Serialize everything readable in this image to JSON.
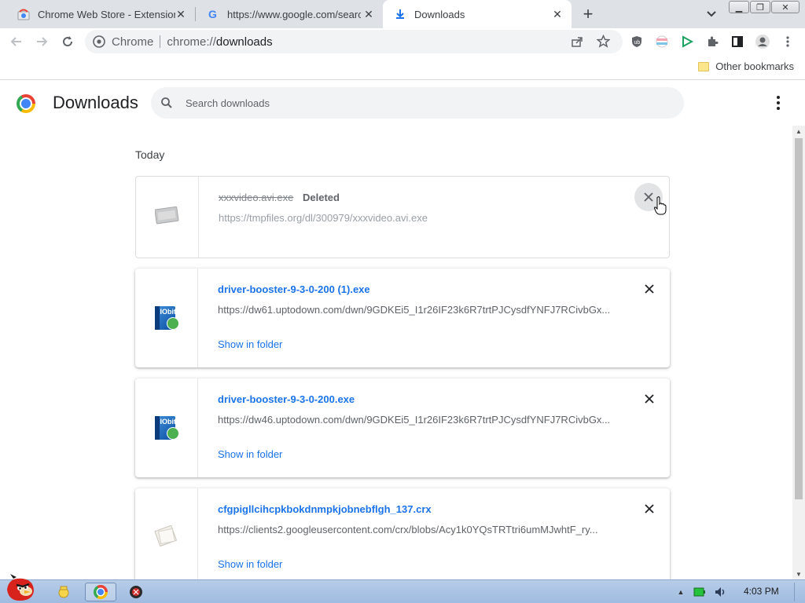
{
  "browser": {
    "tabs": [
      {
        "title": "Chrome Web Store - Extensions",
        "icon": "chrome-web-store-icon",
        "active": false
      },
      {
        "title": "https://www.google.com/search",
        "icon": "google-icon",
        "active": false
      },
      {
        "title": "Downloads",
        "icon": "download-icon",
        "active": true
      }
    ],
    "new_tab": "+",
    "omnibox": {
      "site_label": "Chrome",
      "url_scheme": "chrome://",
      "url_path": "downloads"
    },
    "bookmarks": {
      "other": "Other bookmarks"
    }
  },
  "downloads": {
    "title": "Downloads",
    "search_placeholder": "Search downloads",
    "section_date": "Today",
    "items": [
      {
        "name": "xxxvideo.avi.exe",
        "status": "Deleted",
        "url": "https://tmpfiles.org/dl/300979/xxxvideo.avi.exe",
        "action": ""
      },
      {
        "name": "driver-booster-9-3-0-200 (1).exe",
        "status": "",
        "url": "https://dw61.uptodown.com/dwn/9GDKEi5_I1r26IF23k6R7trtPJCysdfYNFJ7RCivbGx...",
        "action": "Show in folder"
      },
      {
        "name": "driver-booster-9-3-0-200.exe",
        "status": "",
        "url": "https://dw46.uptodown.com/dwn/9GDKEi5_I1r26IF23k6R7trtPJCysdfYNFJ7RCivbGx...",
        "action": "Show in folder"
      },
      {
        "name": "cfgpigllcihcpkbokdnmpkjobnebflgh_137.crx",
        "status": "",
        "url": "https://clients2.googleusercontent.com/crx/blobs/Acy1k0YQsTRTtri6umMJwhtF_ry...",
        "action": "Show in folder"
      }
    ]
  },
  "taskbar": {
    "clock": "4:03 PM"
  },
  "colors": {
    "accent": "#1a73e8",
    "tabstrip": "#dee1e6",
    "taskbar": "#a9c3e4"
  }
}
